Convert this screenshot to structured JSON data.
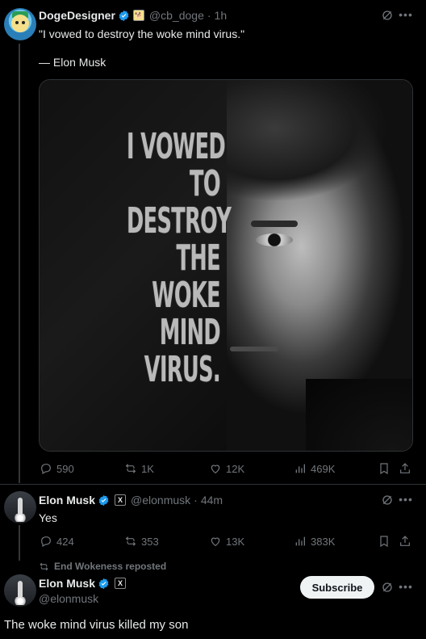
{
  "tweet1": {
    "name": "DogeDesigner",
    "handle": "@cb_doge",
    "dot": "·",
    "time": "1h",
    "text_line1": "\"I vowed to destroy the woke mind virus.\"",
    "text_line2": "— Elon Musk",
    "poster_lines": [
      "I VOWED",
      "TO",
      "DESTROY",
      "THE",
      "WOKE",
      "MIND",
      "VIRUS."
    ],
    "replies": "590",
    "reposts": "1K",
    "likes": "12K",
    "views": "469K"
  },
  "tweet2": {
    "name": "Elon Musk",
    "affiliate": "X",
    "handle": "@elonmusk",
    "dot": "·",
    "time": "44m",
    "text": "Yes",
    "replies": "424",
    "reposts": "353",
    "likes": "13K",
    "views": "383K"
  },
  "tweet3": {
    "repost_note": "End Wokeness reposted",
    "name": "Elon Musk",
    "affiliate": "X",
    "handle": "@elonmusk",
    "subscribe_label": "Subscribe",
    "text": "The woke mind virus killed my son"
  },
  "colors": {
    "background": "#000000",
    "text": "#e7e9ea",
    "muted": "#71767b",
    "verified": "#1d9bf0"
  },
  "icons": [
    "grok-icon",
    "more-icon",
    "reply-icon",
    "repost-icon",
    "like-icon",
    "views-icon",
    "bookmark-icon",
    "share-icon",
    "verified-icon"
  ]
}
